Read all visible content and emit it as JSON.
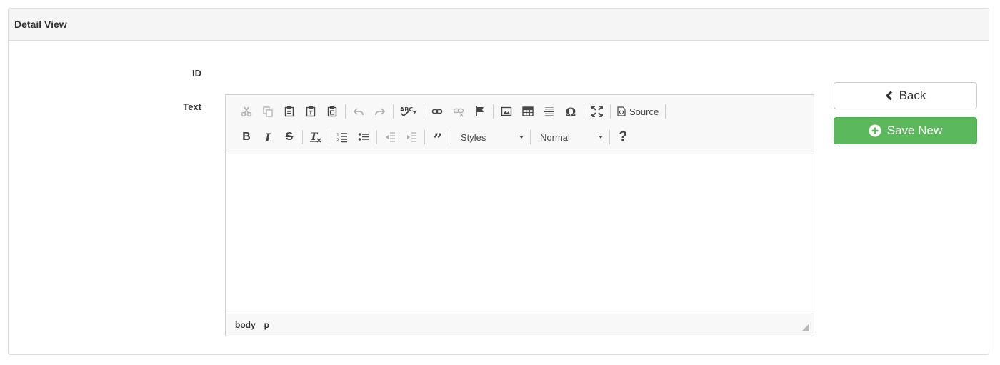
{
  "panel": {
    "title": "Detail View"
  },
  "form": {
    "id_label": "ID",
    "text_label": "Text"
  },
  "editor": {
    "source_label": "Source",
    "styles_combo": "Styles",
    "format_combo": "Normal",
    "help_glyph": "?",
    "path": [
      "body",
      "p"
    ]
  },
  "actions": {
    "back_label": "Back",
    "save_label": "Save New"
  },
  "colors": {
    "save_button": "#5cb85c",
    "panel_heading": "#f5f5f5",
    "toolbar": "#f8f8f8"
  }
}
